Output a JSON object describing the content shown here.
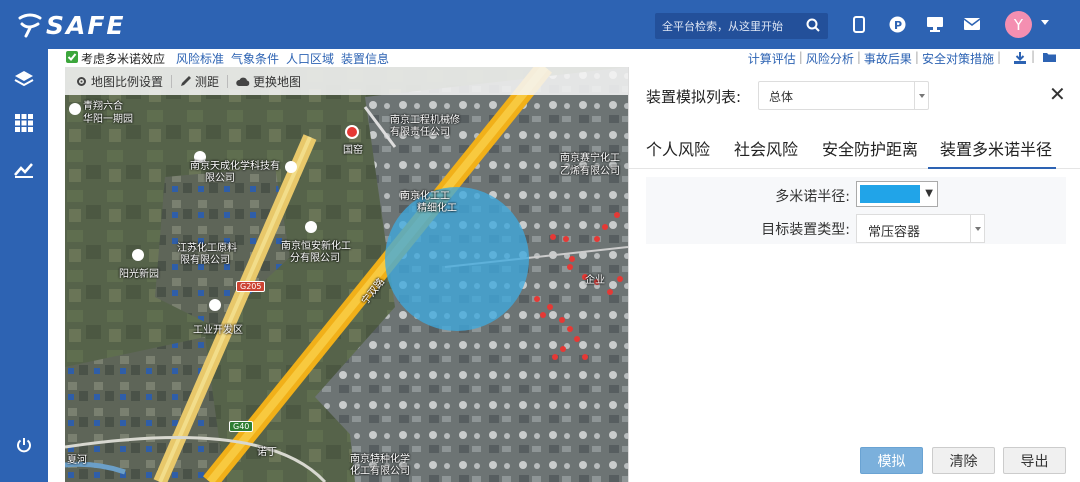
{
  "brand": {
    "logo_text": "SAFE",
    "accent": "#2d63b3"
  },
  "search": {
    "placeholder": "全平台检索，从这里开始"
  },
  "user": {
    "avatar_letter": "Y",
    "avatar_color": "#f48fb1"
  },
  "subbar": {
    "checkbox_label": "考虑多米诺效应",
    "left_links": [
      "风险标准",
      "气象条件",
      "人口区域",
      "装置信息"
    ],
    "right_links": [
      "计算评估",
      "风险分析",
      "事故后果",
      "安全对策措施"
    ]
  },
  "map": {
    "tools": {
      "scale": "地图比例设置",
      "measure": "测距",
      "switch": "更换地图"
    },
    "labels": {
      "l1": "青翔六合",
      "l2": "华阳一期园",
      "l3": "南京天成化学科技有",
      "l4": "限公司",
      "l5": "南京工程机械修",
      "l6": "有限责任公司",
      "l7": "国窑",
      "l8": "南京赛宁化工",
      "l9": "乙烯有限公司",
      "l10": "南京化工工",
      "l11": "精细化工",
      "l12": "江苏化工原料",
      "l13": "限有限公司",
      "l14": "南京恒安新化工",
      "l15": "分有限公司",
      "l16": "阳光新园",
      "l17": "工业开发区",
      "l18": "宁双路",
      "l19": "南京特种化学",
      "l20": "化工有限公司",
      "l21": "夏河",
      "l22": "诺丁"
    },
    "road_shields": {
      "g205": "G205",
      "g40": "G40"
    },
    "circle_color": "#3fa9de"
  },
  "panel": {
    "title": "装置模拟列表:",
    "select_value": "总体",
    "tabs": [
      "个人风险",
      "社会风险",
      "安全防护距离",
      "装置多米诺半径"
    ],
    "active_tab": 3,
    "form": {
      "radius_label": "多米诺半径:",
      "radius_color": "#21a4e8",
      "type_label": "目标装置类型:",
      "type_value": "常压容器"
    },
    "buttons": {
      "simulate": "模拟",
      "clear": "清除",
      "export": "导出"
    }
  }
}
